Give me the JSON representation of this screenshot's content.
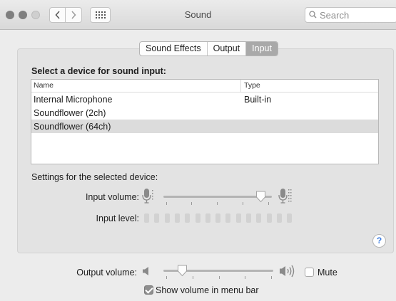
{
  "window": {
    "title": "Sound"
  },
  "search": {
    "placeholder": "Search"
  },
  "tabs": [
    {
      "label": "Sound Effects",
      "active": false
    },
    {
      "label": "Output",
      "active": false
    },
    {
      "label": "Input",
      "active": true
    }
  ],
  "input_pane": {
    "section_title": "Select a device for sound input:",
    "columns": {
      "name": "Name",
      "type": "Type"
    },
    "devices": [
      {
        "name": "Internal Microphone",
        "type": "Built-in",
        "selected": false
      },
      {
        "name": "Soundflower (2ch)",
        "type": "",
        "selected": false
      },
      {
        "name": "Soundflower (64ch)",
        "type": "",
        "selected": true
      }
    ],
    "settings_label": "Settings for the selected device:",
    "input_volume_label": "Input volume:",
    "input_volume_value": 0.9,
    "input_level_label": "Input level:",
    "input_level_active_bars": 0,
    "input_level_total_bars": 15
  },
  "output": {
    "volume_label": "Output volume:",
    "volume_value": 0.17,
    "mute_label": "Mute",
    "mute_checked": false,
    "show_in_menu_bar_label": "Show volume in menu bar",
    "show_in_menu_bar_checked": true
  },
  "colors": {
    "selected_tab": "#a9a9a9",
    "selected_row": "#dcdcdc",
    "help_accent": "#3a7be0"
  }
}
